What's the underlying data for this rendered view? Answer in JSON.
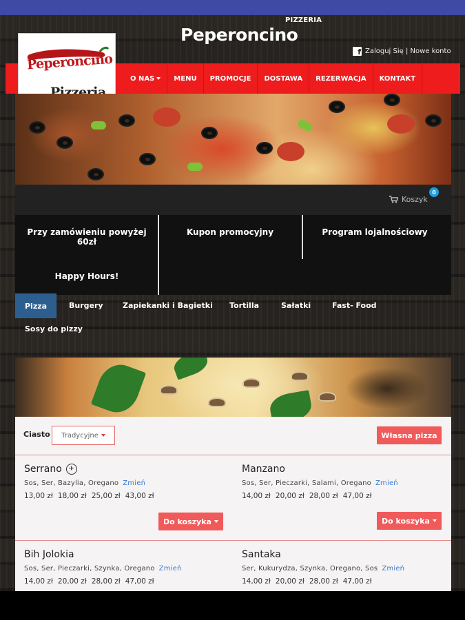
{
  "header": {
    "brand_sub": "PIZZERIA",
    "brand_title": "Peperoncino",
    "login_text": "Zaloguj Się | Nowe konto",
    "logo_line1": "Peperoncino",
    "logo_line2": "Pizzeria"
  },
  "nav": {
    "items": [
      {
        "label": "O NAS",
        "has_dropdown": true
      },
      {
        "label": "MENU"
      },
      {
        "label": "PROMOCJE"
      },
      {
        "label": "DOSTAWA"
      },
      {
        "label": "REZERWACJA"
      },
      {
        "label": "KONTAKT"
      }
    ]
  },
  "cart": {
    "label": "Koszyk",
    "count": "0"
  },
  "promos": {
    "p1": "Przy zamówieniu powyżej 60zł",
    "p2": "Kupon promocyjny",
    "p3": "Program lojalnościowy",
    "p4": "Happy Hours!"
  },
  "categories": {
    "pizza": "Pizza",
    "burgery": "Burgery",
    "zapiekanki": "Zapiekanki i Bagietki",
    "tortilla": "Tortilla",
    "salatki": "Sałatki",
    "fastfood": "Fast- Food",
    "sosy": "Sosy do pizzy"
  },
  "filters": {
    "ciasto_label": "Ciasto",
    "ciasto_value": "Tradycyjne",
    "custom_pizza_button": "Własna pizza"
  },
  "products": {
    "p1": {
      "name": "Serrano",
      "ingredients": "Sos, Ser, Bazylia, Oregano",
      "change": "Zmień",
      "prices": [
        "13,00 zł",
        "18,00 zł",
        "25,00 zł",
        "43,00 zł"
      ],
      "add": "Do koszyka"
    },
    "p2": {
      "name": "Manzano",
      "ingredients": "Sos, Ser, Pieczarki, Salami, Oregano",
      "change": "Zmień",
      "prices": [
        "14,00 zł",
        "20,00 zł",
        "28,00 zł",
        "47,00 zł"
      ],
      "add": "Do koszyka"
    },
    "p3": {
      "name": "Bih Jolokia",
      "ingredients": "Sos, Ser, Pieczarki, Szynka, Oregano",
      "change": "Zmień",
      "prices": [
        "14,00 zł",
        "20,00 zł",
        "28,00 zł",
        "47,00 zł"
      ]
    },
    "p4": {
      "name": "Santaka",
      "ingredients": "Ser, Kukurydza, Szynka, Oregano, Sos",
      "change": "Zmień",
      "prices": [
        "14,00 zł",
        "20,00 zł",
        "28,00 zł",
        "47,00 zł"
      ]
    }
  },
  "colors": {
    "accent_red": "#ee1c1c",
    "active_tab": "#2d5f8e",
    "top_bar": "#3e4aa6",
    "badge": "#1e9fe0"
  }
}
